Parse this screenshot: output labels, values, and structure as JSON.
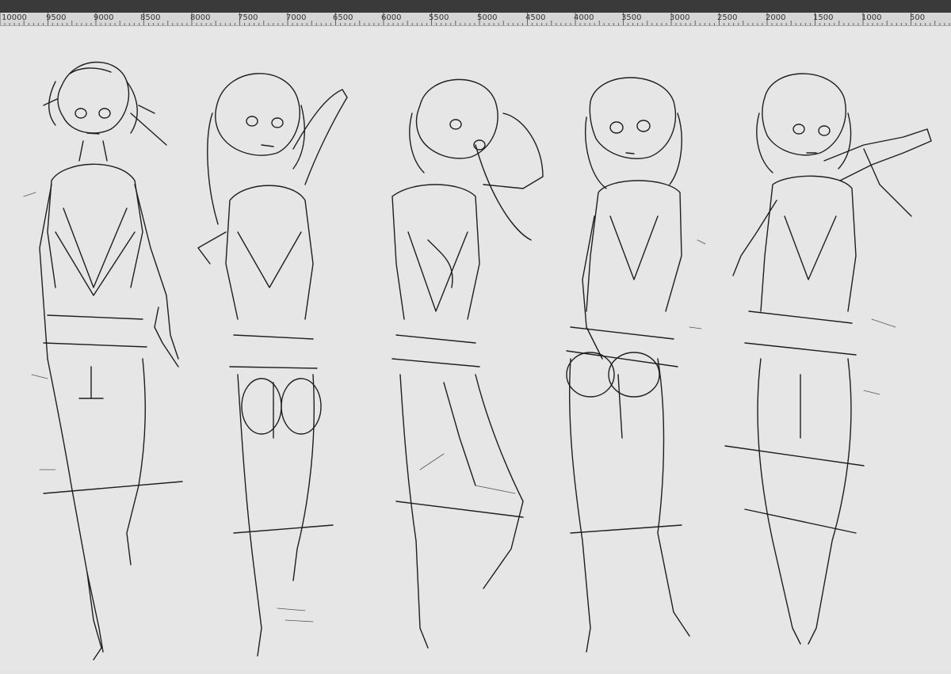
{
  "window": {
    "title_bar": "",
    "background_color": "#e4e4e4",
    "topbar_color": "#3a3a3a"
  },
  "ruler": {
    "labels": [
      "10000",
      "9500",
      "9000",
      "8500",
      "8000",
      "7500",
      "7000",
      "6500",
      "6000",
      "5500",
      "5000",
      "4500",
      "4000",
      "3500",
      "3000",
      "2500",
      "2000",
      "1500",
      "1000",
      "500"
    ]
  },
  "canvas": {
    "content": "pencil-sketch",
    "figure_count": 5,
    "figures": [
      {
        "id": "figure-1"
      },
      {
        "id": "figure-2"
      },
      {
        "id": "figure-3"
      },
      {
        "id": "figure-4"
      },
      {
        "id": "figure-5"
      }
    ]
  }
}
